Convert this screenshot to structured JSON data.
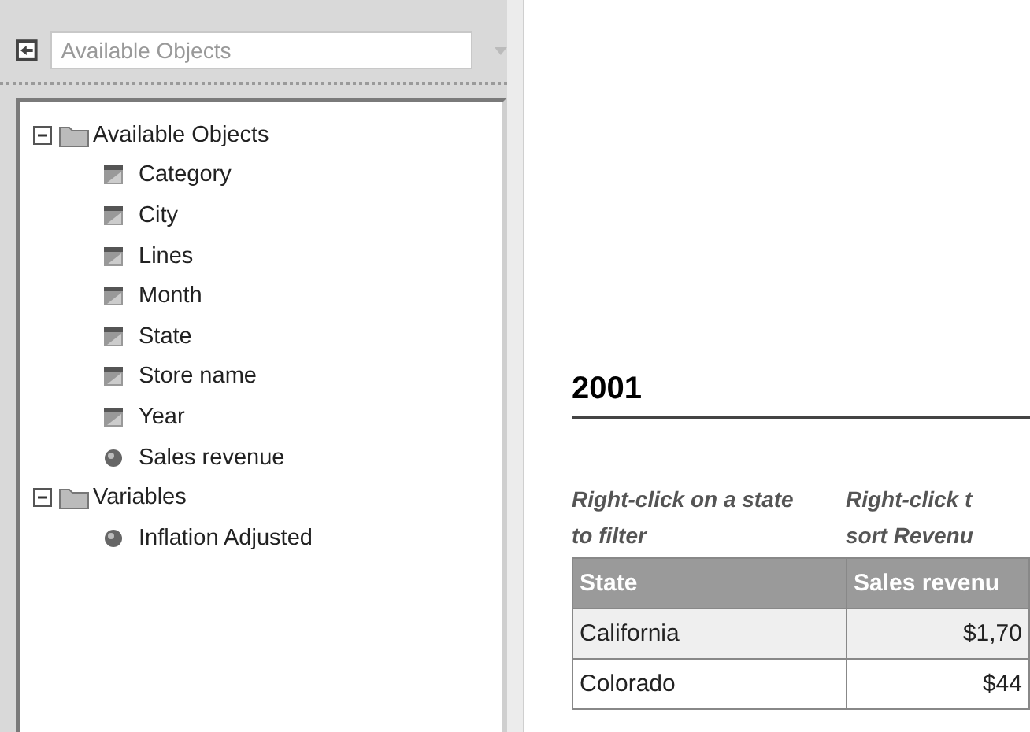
{
  "sidebar": {
    "selector": {
      "value": "Available Objects"
    },
    "tree": [
      {
        "label": "Available Objects",
        "kind": "folder",
        "expanded": true,
        "children": [
          {
            "label": "Category",
            "kind": "dimension"
          },
          {
            "label": "City",
            "kind": "dimension"
          },
          {
            "label": "Lines",
            "kind": "dimension"
          },
          {
            "label": "Month",
            "kind": "dimension"
          },
          {
            "label": "State",
            "kind": "dimension"
          },
          {
            "label": "Store name",
            "kind": "dimension"
          },
          {
            "label": "Year",
            "kind": "dimension"
          },
          {
            "label": "Sales revenue",
            "kind": "measure"
          }
        ]
      },
      {
        "label": "Variables",
        "kind": "folder",
        "expanded": true,
        "children": [
          {
            "label": "Inflation Adjusted",
            "kind": "measure"
          }
        ]
      }
    ]
  },
  "report": {
    "title": "2001",
    "notes": [
      "Right-click on a state to filter",
      "Right-click t sort Revenu"
    ],
    "table": {
      "columns": [
        "State",
        "Sales revenu"
      ],
      "rows": [
        [
          "California",
          "$1,70"
        ],
        [
          "Colorado",
          "$44"
        ]
      ]
    }
  }
}
